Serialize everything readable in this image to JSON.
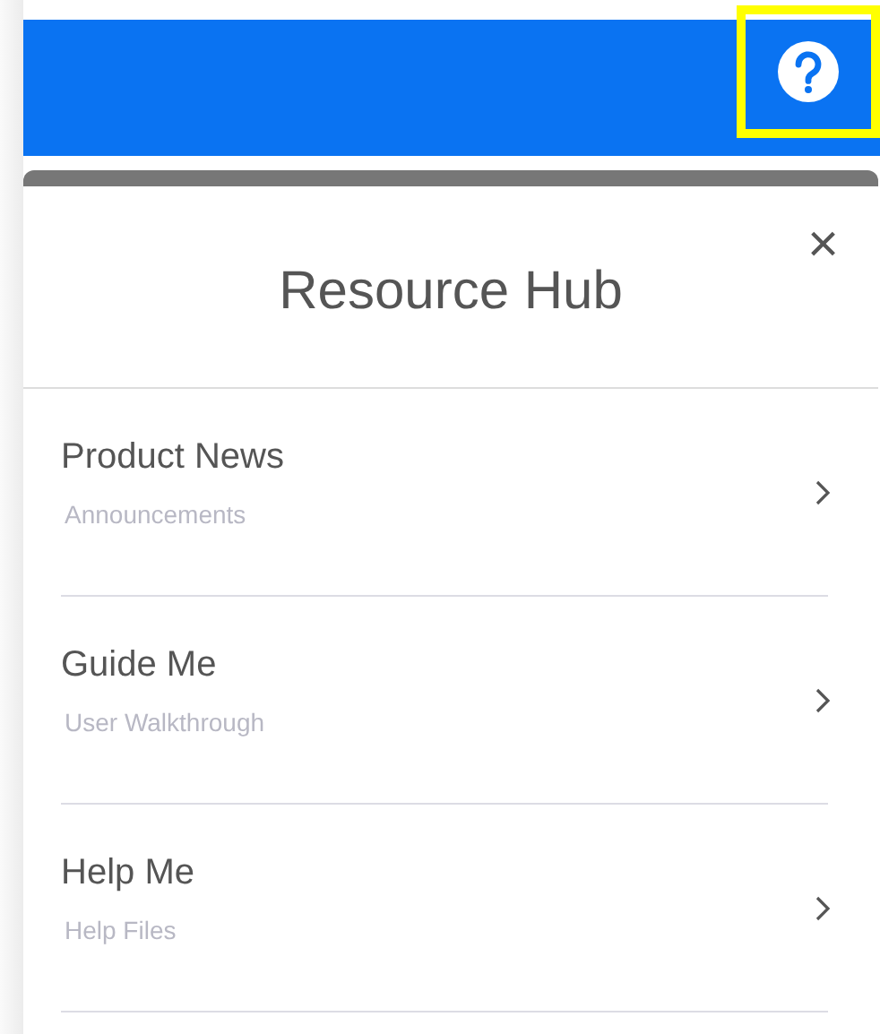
{
  "panel": {
    "title": "Resource Hub",
    "close_label": "×"
  },
  "items": [
    {
      "title": "Product News",
      "subtitle": "Announcements"
    },
    {
      "title": "Guide Me",
      "subtitle": "User Walkthrough"
    },
    {
      "title": "Help Me",
      "subtitle": "Help Files"
    }
  ]
}
